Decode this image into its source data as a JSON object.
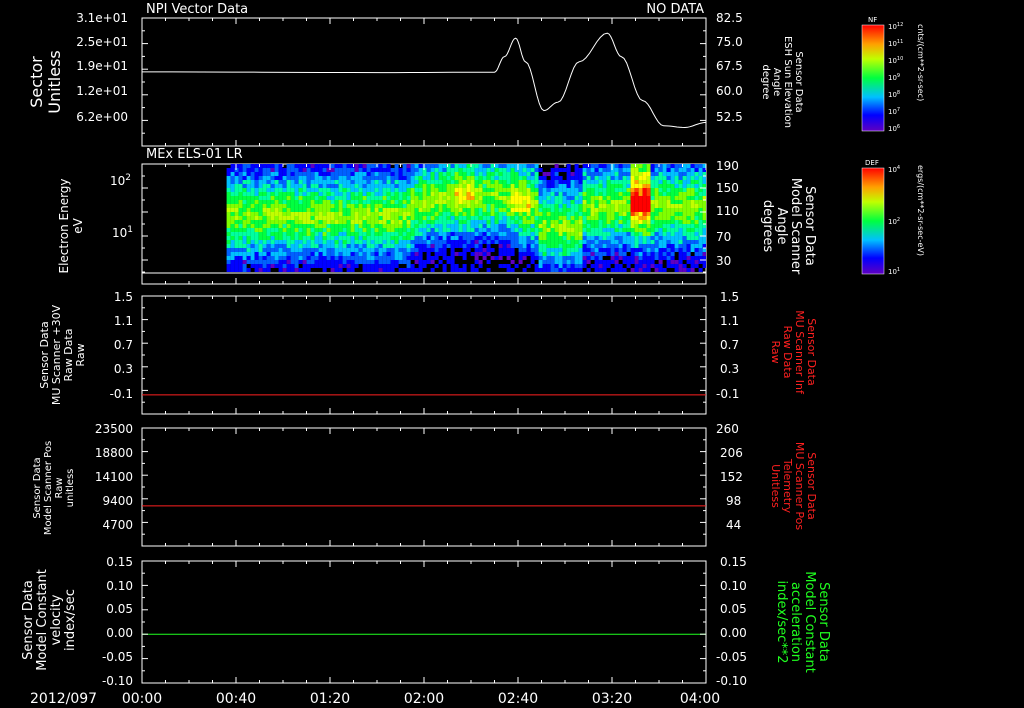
{
  "panels": [
    {
      "left_labels": [
        "Sector",
        "Unitless"
      ],
      "title_left": "NPI Vector Data",
      "title_right": "NO DATA",
      "left_ticks": [
        "3.1e+01",
        "2.5e+01",
        "1.9e+01",
        "1.2e+01",
        "6.2e+00"
      ],
      "right_ticks": [
        "82.5",
        "75.0",
        "67.5",
        "60.0",
        "52.5"
      ],
      "right_labels": [
        "Sensor Data",
        "ESH Sun Elevation",
        "Angle",
        "degree"
      ],
      "right_label_color": "#ffffff"
    },
    {
      "title_left": "MEx ELS-01 LR",
      "left_labels": [
        "Electron Energy",
        "eV"
      ],
      "left_ticks": [
        "10",
        "10"
      ],
      "left_tick_exps": [
        "2",
        "1"
      ],
      "right_ticks": [
        "190",
        "150",
        "110",
        "70",
        "30"
      ],
      "right_labels": [
        "Sensor Data",
        "Model Scanner",
        "Angle",
        "degrees"
      ],
      "right_label_color": "#ffffff"
    },
    {
      "left_labels": [
        "Sensor Data",
        "MU Scanner +30V",
        "Raw Data",
        "Raw"
      ],
      "left_ticks": [
        "1.5",
        "1.1",
        "0.7",
        "0.3",
        "-0.1"
      ],
      "right_ticks": [
        "1.5",
        "1.1",
        "0.7",
        "0.3",
        "-0.1"
      ],
      "right_labels": [
        "Sensor Data",
        "MU Scanner Inf",
        "Raw Data",
        "Raw"
      ],
      "right_label_color": "#ff2020"
    },
    {
      "left_labels": [
        "Sensor Data",
        "Model Scanner Pos",
        "Raw",
        "unitless"
      ],
      "left_ticks": [
        "23500",
        "18800",
        "14100",
        "9400",
        "4700"
      ],
      "right_ticks": [
        "260",
        "206",
        "152",
        "98",
        "44"
      ],
      "right_labels": [
        "Sensor Data",
        "MU Scanner Pos",
        "Telemetry",
        "Unitless"
      ],
      "right_label_color": "#ff2020"
    },
    {
      "left_labels": [
        "Sensor Data",
        "Model Constant",
        "velocity",
        "index/sec"
      ],
      "left_ticks": [
        "0.15",
        "0.10",
        "0.05",
        "0.00",
        "-0.05",
        "-0.10"
      ],
      "right_ticks": [
        "0.15",
        "0.10",
        "0.05",
        "0.00",
        "-0.05",
        "-0.10"
      ],
      "right_labels": [
        "Sensor Data",
        "Model Constant",
        "acceleration",
        "index/sec**2"
      ],
      "right_label_color": "#20ff20"
    }
  ],
  "x_axis": {
    "date_label": "2012/097",
    "ticks": [
      "00:00",
      "00:40",
      "01:20",
      "02:00",
      "02:40",
      "03:20",
      "04:00"
    ]
  },
  "colorbars": [
    {
      "title": "NF",
      "tick_mants": [
        "10",
        "10",
        "10",
        "10",
        "10",
        "10",
        "10"
      ],
      "tick_exps": [
        "12",
        "11",
        "10",
        "9",
        "8",
        "7",
        "6"
      ],
      "unit": "cnts/(cm**2-sr-sec)"
    },
    {
      "title": "DEF",
      "tick_mants": [
        "10",
        "10",
        "10"
      ],
      "tick_exps": [
        "4",
        "2",
        "1"
      ],
      "unit": "ergs/(cm**2-sr-sec-eV)"
    }
  ],
  "chart_data": [
    {
      "type": "line",
      "x_unit": "hours since 2012/097 00:00",
      "xlim": [
        0,
        4
      ],
      "series": [
        {
          "axis": "right",
          "color": "#ffffff",
          "x": [
            0,
            1.7,
            2.5,
            2.57,
            2.65,
            2.72,
            2.85,
            2.95,
            3.1,
            3.3,
            3.4,
            3.55,
            3.7,
            3.85,
            4.0
          ],
          "y": [
            69.0,
            68.8,
            68.9,
            73.5,
            79.0,
            72.0,
            57.5,
            60.0,
            72.0,
            80.5,
            73.5,
            60.5,
            53.0,
            52.5,
            54.0
          ]
        }
      ],
      "ylim_right": [
        47,
        85
      ]
    },
    {
      "type": "heatmap",
      "x_unit": "hours since 2012/097 00:00",
      "y_scale": "log",
      "ylabel": "Electron Energy",
      "ylim": [
        2,
        200
      ],
      "data_start": 0.6,
      "data_end": 4.0,
      "colormap": "rainbow"
    },
    {
      "type": "line",
      "series": [
        {
          "color": "#ff2020",
          "x": [
            0,
            4
          ],
          "y": [
            -0.05,
            -0.05
          ]
        }
      ],
      "ylim": [
        -0.35,
        1.5
      ]
    },
    {
      "type": "line",
      "series": [
        {
          "color": "#ff2020",
          "x": [
            0,
            4
          ],
          "y": [
            8000,
            8000
          ]
        }
      ],
      "ylim": [
        0,
        23500
      ]
    },
    {
      "type": "line",
      "series": [
        {
          "color": "#20ff20",
          "x": [
            0,
            4
          ],
          "y": [
            0.0,
            0.0
          ]
        }
      ],
      "ylim": [
        -0.1,
        0.15
      ]
    }
  ]
}
